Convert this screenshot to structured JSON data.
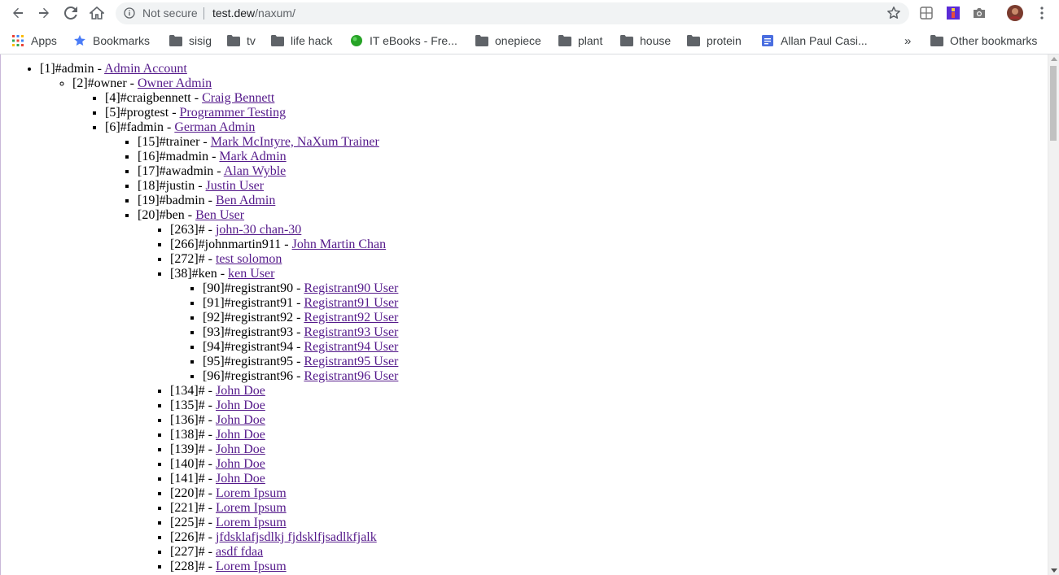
{
  "browser": {
    "omnibox": {
      "security": "Not secure",
      "host": "test.dew",
      "path": "/naxum/"
    },
    "bookmarks": [
      {
        "label": "Apps",
        "icon": "apps-grid-icon"
      },
      {
        "label": "Bookmarks",
        "icon": "star-icon"
      },
      {
        "label": "sisig",
        "icon": "folder-icon"
      },
      {
        "label": "tv",
        "icon": "folder-icon"
      },
      {
        "label": "life hack",
        "icon": "folder-icon"
      },
      {
        "label": "IT eBooks - Fre...",
        "icon": "green-circle-icon"
      },
      {
        "label": "onepiece",
        "icon": "folder-icon"
      },
      {
        "label": "plant",
        "icon": "folder-icon"
      },
      {
        "label": "house",
        "icon": "folder-icon"
      },
      {
        "label": "protein",
        "icon": "folder-icon"
      },
      {
        "label": "Allan Paul Casi...",
        "icon": "doc-icon"
      }
    ],
    "overflow": "»",
    "other_bookmarks": "Other bookmarks"
  },
  "tree": {
    "admin": {
      "prefix": "[1]#admin - ",
      "link": "Admin Account"
    },
    "owner": {
      "prefix": "[2]#owner - ",
      "link": "Owner Admin"
    },
    "owner_children": [
      {
        "prefix": "[4]#craigbennett - ",
        "link": "Craig Bennett"
      },
      {
        "prefix": "[5]#progtest - ",
        "link": "Programmer Testing"
      }
    ],
    "fadmin": {
      "prefix": "[6]#fadmin - ",
      "link": "German Admin"
    },
    "fadmin_children": [
      {
        "prefix": "[15]#trainer - ",
        "link": "Mark McIntyre, NaXum Trainer"
      },
      {
        "prefix": "[16]#madmin - ",
        "link": "Mark Admin"
      },
      {
        "prefix": "[17]#awadmin - ",
        "link": "Alan Wyble"
      },
      {
        "prefix": "[18]#justin - ",
        "link": "Justin User"
      },
      {
        "prefix": "[19]#badmin - ",
        "link": "Ben Admin"
      }
    ],
    "ben": {
      "prefix": "[20]#ben - ",
      "link": "Ben User"
    },
    "ben_children_top": [
      {
        "prefix": "[263]# - ",
        "link": "john-30 chan-30"
      },
      {
        "prefix": "[266]#johnmartin911 - ",
        "link": "John Martin Chan"
      },
      {
        "prefix": "[272]# - ",
        "link": "test solomon"
      }
    ],
    "ken": {
      "prefix": "[38]#ken - ",
      "link": "ken User"
    },
    "ken_children": [
      {
        "prefix": "[90]#registrant90 - ",
        "link": "Registrant90 User"
      },
      {
        "prefix": "[91]#registrant91 - ",
        "link": "Registrant91 User"
      },
      {
        "prefix": "[92]#registrant92 - ",
        "link": "Registrant92 User"
      },
      {
        "prefix": "[93]#registrant93 - ",
        "link": "Registrant93 User"
      },
      {
        "prefix": "[94]#registrant94 - ",
        "link": "Registrant94 User"
      },
      {
        "prefix": "[95]#registrant95 - ",
        "link": "Registrant95 User"
      },
      {
        "prefix": "[96]#registrant96 - ",
        "link": "Registrant96 User"
      }
    ],
    "ben_children_bottom": [
      {
        "prefix": "[134]# - ",
        "link": "John Doe"
      },
      {
        "prefix": "[135]# - ",
        "link": "John Doe"
      },
      {
        "prefix": "[136]# - ",
        "link": "John Doe"
      },
      {
        "prefix": "[138]# - ",
        "link": "John Doe"
      },
      {
        "prefix": "[139]# - ",
        "link": "John Doe"
      },
      {
        "prefix": "[140]# - ",
        "link": "John Doe"
      },
      {
        "prefix": "[141]# - ",
        "link": "John Doe"
      },
      {
        "prefix": "[220]# - ",
        "link": "Lorem Ipsum"
      },
      {
        "prefix": "[221]# - ",
        "link": "Lorem Ipsum"
      },
      {
        "prefix": "[225]# - ",
        "link": "Lorem Ipsum"
      },
      {
        "prefix": "[226]# - ",
        "link": "jfdsklafjsdlkj fjdsklfjsadlkfjalk"
      },
      {
        "prefix": "[227]# - ",
        "link": "asdf fdaa"
      },
      {
        "prefix": "[228]# - ",
        "link": "Lorem Ipsum"
      }
    ]
  },
  "colors": {
    "link_visited": "#551a8b",
    "omnibox_bg": "#f1f3f4"
  }
}
